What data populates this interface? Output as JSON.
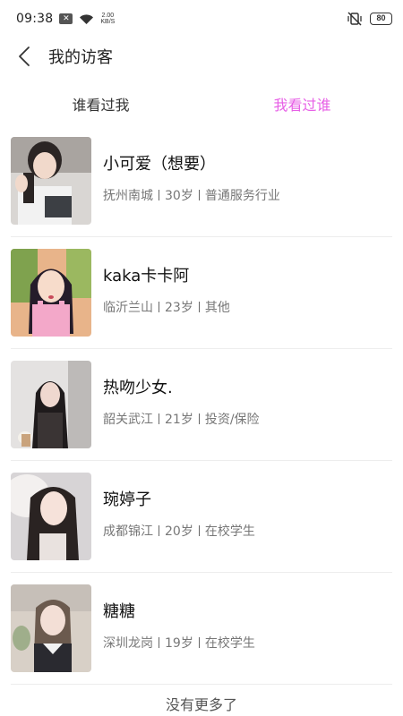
{
  "status_bar": {
    "time": "09:38",
    "speed_value": "2.00",
    "speed_unit": "KB/S",
    "battery": "80"
  },
  "header": {
    "title": "我的访客"
  },
  "tabs": [
    {
      "label": "谁看过我",
      "active": false
    },
    {
      "label": "我看过谁",
      "active": true
    }
  ],
  "visitors": [
    {
      "name": "小可爱（想要）",
      "location": "抚州南城",
      "age": "30岁",
      "occupation": "普通服务行业"
    },
    {
      "name": "kaka卡卡阿",
      "location": "临沂兰山",
      "age": "23岁",
      "occupation": "其他"
    },
    {
      "name": "热吻少女.",
      "location": "韶关武江",
      "age": "21岁",
      "occupation": "投资/保险"
    },
    {
      "name": "琬婷子",
      "location": "成都锦江",
      "age": "20岁",
      "occupation": "在校学生"
    },
    {
      "name": "糖糖",
      "location": "深圳龙岗",
      "age": "19岁",
      "occupation": "在校学生"
    }
  ],
  "footer": {
    "no_more_text": "没有更多了"
  },
  "colors": {
    "accent": "#e75fe6",
    "divider": "#ededed",
    "meta_text": "#777777"
  }
}
